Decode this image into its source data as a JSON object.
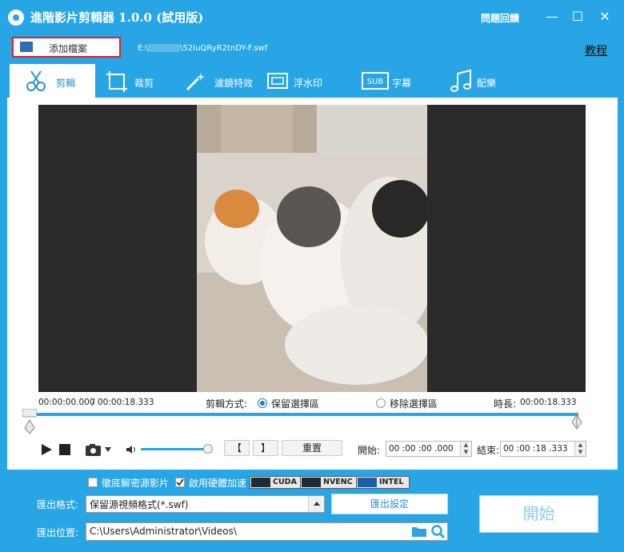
{
  "title_bar": {
    "app_title": "進階影片剪輯器 1.0.0 (試用版)",
    "feedback_label": "問題回饋",
    "minimize_symbol": "—",
    "maximize_symbol": "☐",
    "close_symbol": "✕"
  },
  "file_row": {
    "add_file_label": "添加檔案",
    "file_path_prefix": "E:\\",
    "file_path_suffix": "\\52IuQRyR2tnDY-F.swf",
    "tutorial_link": "教程"
  },
  "tabs": [
    {
      "label": "剪輯",
      "icon": "scissors-icon",
      "active": true
    },
    {
      "label": "裁剪",
      "icon": "crop-icon",
      "active": false
    },
    {
      "label": "濾鏡特效",
      "icon": "magic-wand-icon",
      "active": false
    },
    {
      "label": "浮水印",
      "icon": "watermark-icon",
      "active": false
    },
    {
      "label": "字幕",
      "icon": "subtitle-icon",
      "active": false
    },
    {
      "label": "配樂",
      "icon": "music-note-icon",
      "active": false
    }
  ],
  "subtitle_icon_text": "SUB",
  "timeline": {
    "current_time": "00:00:00.000",
    "separator": "/",
    "total_time": "00:00:18.333",
    "cut_mode_label": "剪輯方式:",
    "keep_selection_label": "保留選擇區",
    "remove_selection_label": "移除選擇區",
    "selected_mode": "keep",
    "duration_label": "時長:",
    "duration_value": "00:00:18.333",
    "slider_start_fraction": 0,
    "slider_end_fraction": 1
  },
  "controls": {
    "mark_in_label": "【",
    "mark_out_label": "】",
    "reset_label": "重置",
    "start_label": "開始:",
    "start_value": "00 :00 :00 .000",
    "end_label": "結束:",
    "end_value": "00 :00 :18 .333",
    "volume_level": 1
  },
  "options": {
    "decrypt_label": "徹底解密源影片",
    "decrypt_checked": false,
    "hw_accel_label": "啟用硬體加速",
    "hw_accel_checked": true,
    "badges": [
      "CUDA",
      "NVENC",
      "INTEL"
    ]
  },
  "export": {
    "format_label": "匯出格式:",
    "format_value": "保留源視頻格式(*.swf)",
    "settings_label": "匯出設定",
    "location_label": "匯出位置:",
    "location_value": "C:\\Users\\Administrator\\Videos\\",
    "start_button_label": "開始"
  },
  "colors": {
    "accent": "#27a5e4",
    "highlight_border": "#e01f2a"
  }
}
